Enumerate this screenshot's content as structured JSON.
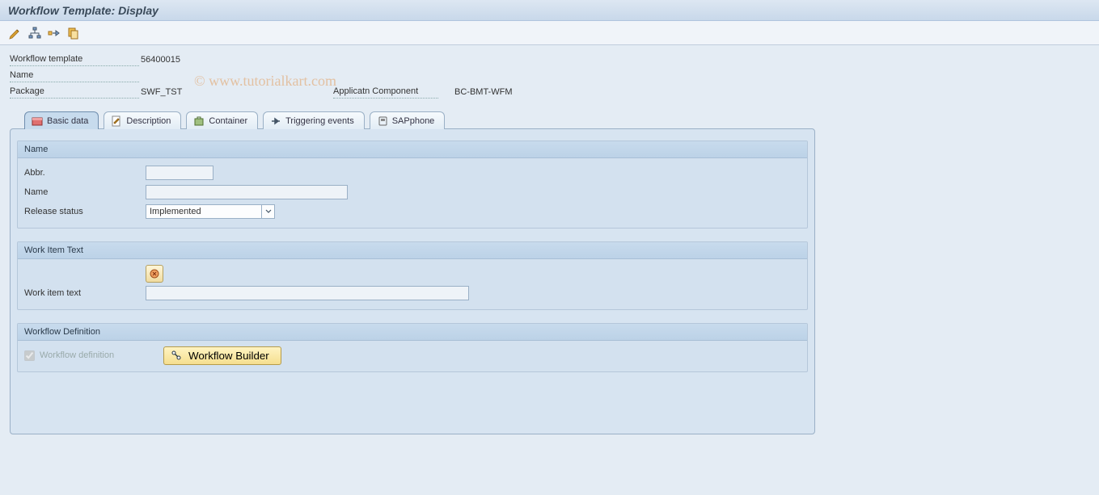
{
  "title": "Workflow Template: Display",
  "watermark": "© www.tutorialkart.com",
  "header": {
    "workflow_template_label": "Workflow template",
    "workflow_template_value": "56400015",
    "name_label": "Name",
    "name_value": "",
    "package_label": "Package",
    "package_value": "SWF_TST",
    "app_comp_label": "Applicatn Component",
    "app_comp_value": "BC-BMT-WFM"
  },
  "tabs": [
    {
      "label": "Basic data",
      "active": true
    },
    {
      "label": "Description",
      "active": false
    },
    {
      "label": "Container",
      "active": false
    },
    {
      "label": "Triggering events",
      "active": false
    },
    {
      "label": "SAPphone",
      "active": false
    }
  ],
  "group_name": {
    "title": "Name",
    "abbr_label": "Abbr.",
    "abbr_value": "",
    "name_label": "Name",
    "name_value": "",
    "release_status_label": "Release status",
    "release_status_value": "Implemented"
  },
  "group_workitem": {
    "title": "Work Item Text",
    "work_item_text_label": "Work item text",
    "work_item_text_value": ""
  },
  "group_wfdef": {
    "title": "Workflow Definition",
    "checkbox_label": "Workflow definition",
    "button_label": "Workflow Builder"
  }
}
